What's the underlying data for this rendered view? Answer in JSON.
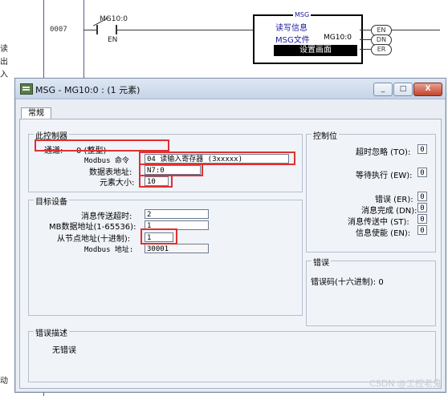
{
  "ladder": {
    "rung_number": "0007",
    "contact_label": "MG10:0",
    "contact_sub": "EN",
    "msg_block": {
      "title": "MSG",
      "line1": "读写信息",
      "line2_left": "MSG文件",
      "line2_right": "MG10:0",
      "setup_button": "设置画面"
    },
    "coils": [
      "EN",
      "DN",
      "ER"
    ],
    "left_fragments": [
      "读",
      "出",
      "入",
      "动"
    ]
  },
  "dialog": {
    "title": "MSG - MG10:0 : (1 元素)",
    "buttons": {
      "minimize": "_",
      "maximize": "□",
      "close": "X"
    },
    "tab_label": "常规",
    "this_controller": {
      "title": "此控制器",
      "channel_label": "通道:",
      "channel_value": "0 (整型)",
      "modbus_cmd_label": "Modbus 命令",
      "modbus_cmd_value": "04 读输入寄存器 (3xxxxx)",
      "data_table_label": "数据表地址:",
      "data_table_value": "N7:0",
      "element_size_label": "元素大小:",
      "element_size_value": "10"
    },
    "target_device": {
      "title": "目标设备",
      "timeout_label": "消息传送超时:",
      "timeout_value": "2",
      "mb_addr_label": "MB数据地址(1-65536):",
      "mb_addr_value": "1",
      "slave_addr_label": "从节点地址(十进制):",
      "slave_addr_value": "1",
      "modbus_addr_label": "Modbus 地址:",
      "modbus_addr_value": "30001"
    },
    "control_bits": {
      "title": "控制位",
      "items": [
        {
          "label": "超时忽略 (TO):",
          "value": "0"
        },
        {
          "label": "等待执行 (EW):",
          "value": "0"
        },
        {
          "label": "错误 (ER):",
          "value": "0"
        },
        {
          "label": "消息完成 (DN):",
          "value": "0"
        },
        {
          "label": "消息传送中 (ST):",
          "value": "0"
        },
        {
          "label": "信息使能 (EN):",
          "value": "0"
        }
      ]
    },
    "error": {
      "title": "错误",
      "code_text": "错误码(十六进制): 0"
    },
    "error_desc": {
      "title": "错误描述",
      "text": "无错误"
    }
  },
  "watermark": "CSDN @工控老鬼"
}
